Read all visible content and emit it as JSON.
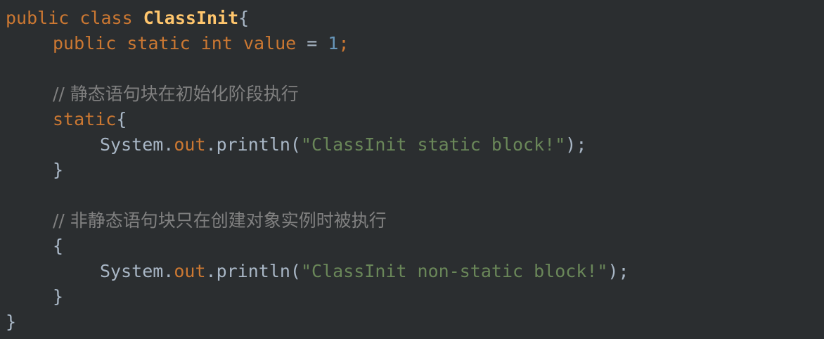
{
  "code": {
    "l1": {
      "kw_public": "public",
      "kw_class": "class",
      "class_name": "ClassInit",
      "brace": "{"
    },
    "l2": {
      "kw_public": "public",
      "kw_static": "static",
      "kw_int": "int",
      "var": "value",
      "eq": "=",
      "num": "1",
      "semi": ";"
    },
    "l4": {
      "comment": "// 静态语句块在初始化阶段执行"
    },
    "l5": {
      "kw_static": "static",
      "brace": "{"
    },
    "l6": {
      "sys": "System.",
      "out": "out",
      "println": ".println(",
      "str": "\"ClassInit static block!\"",
      "end": ");"
    },
    "l7": {
      "brace": "}"
    },
    "l9": {
      "comment": "// 非静态语句块只在创建对象实例时被执行"
    },
    "l10": {
      "brace": "{"
    },
    "l11": {
      "sys": "System.",
      "out": "out",
      "println": ".println(",
      "str": "\"ClassInit non-static block!\"",
      "end": ");"
    },
    "l12": {
      "brace": "}"
    },
    "l13": {
      "brace": "}"
    }
  }
}
